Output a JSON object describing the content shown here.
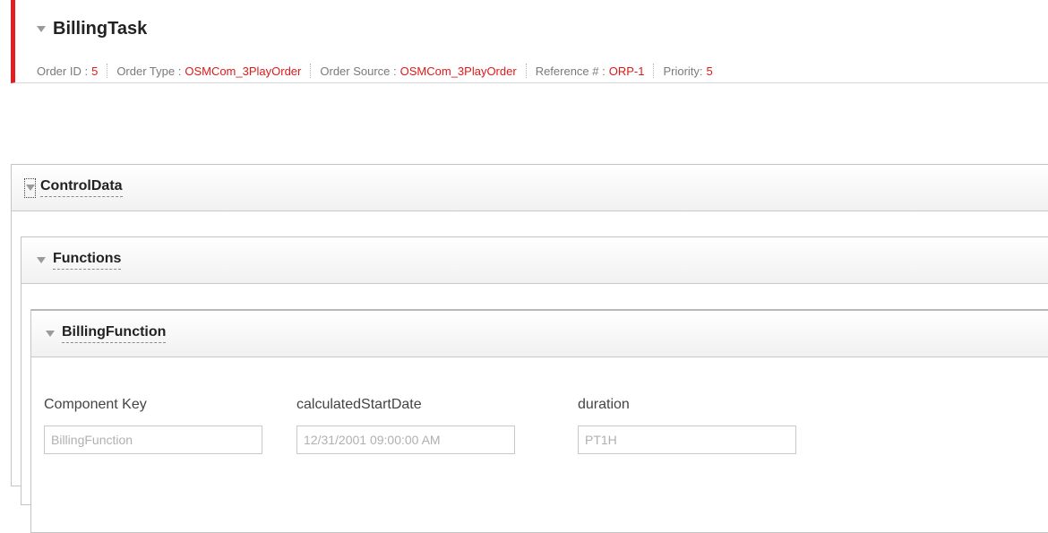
{
  "task": {
    "title": "BillingTask",
    "info": [
      {
        "label": "Order ID :",
        "value": "5"
      },
      {
        "label": "Order Type :",
        "value": "OSMCom_3PlayOrder"
      },
      {
        "label": "Order Source :",
        "value": "OSMCom_3PlayOrder"
      },
      {
        "label": "Reference # :",
        "value": "ORP-1"
      },
      {
        "label": "Priority:",
        "value": "5"
      }
    ]
  },
  "panels": {
    "control_data": {
      "title": "ControlData"
    },
    "functions": {
      "title": "Functions"
    },
    "billing_function": {
      "title": "BillingFunction"
    }
  },
  "fields": [
    {
      "label": "Component Key",
      "value": "BillingFunction"
    },
    {
      "label": "calculatedStartDate",
      "value": "12/31/2001 09:00:00 AM"
    },
    {
      "label": "duration",
      "value": "PT1H"
    }
  ],
  "colors": {
    "accent_red": "#e02020",
    "value_red": "#e01818"
  }
}
